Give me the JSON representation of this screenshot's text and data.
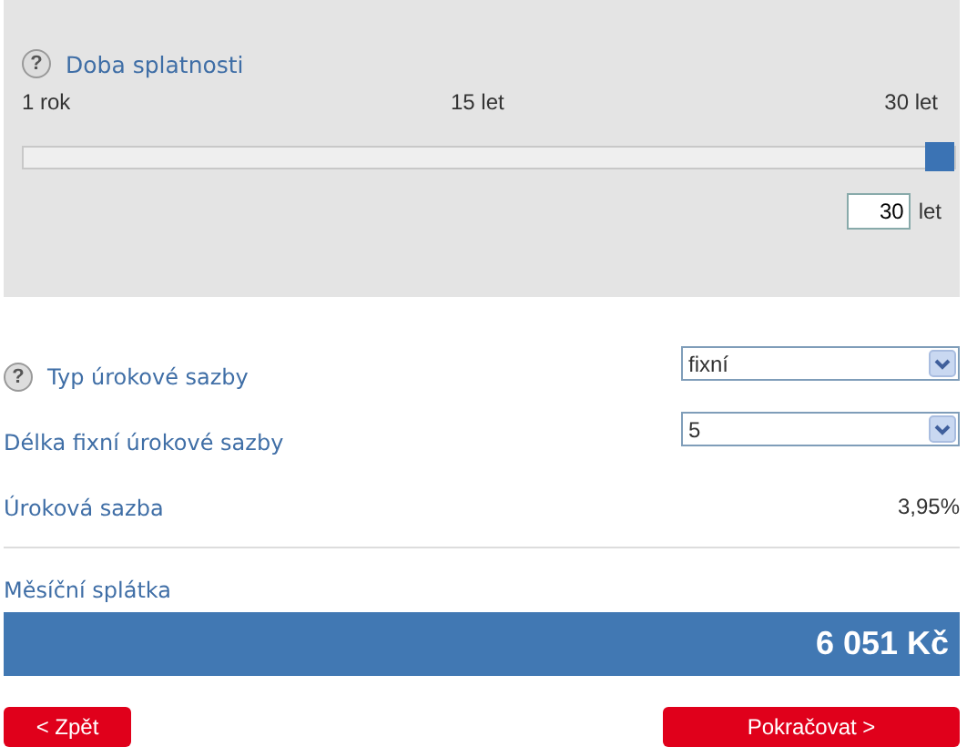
{
  "term": {
    "title": "Doba splatnosti",
    "help": "?",
    "scale": [
      "1 rok",
      "15 let",
      "30 let"
    ],
    "level": 1,
    "value": "30",
    "unit": "let"
  },
  "rows": [
    {
      "kind": "select",
      "label": "Typ úrokové sazby",
      "help": "?",
      "value": "fixní"
    },
    {
      "kind": "select",
      "label": "Délka fixní úrokové sazby",
      "value": "5"
    },
    {
      "kind": "text",
      "label": "Úroková sazba",
      "value": "3,95%"
    }
  ],
  "payment": {
    "label": "Měsíční splátka",
    "value": "6 051 Kč"
  },
  "buttons": {
    "back": "< Zpět",
    "next": "Pokračovat >"
  }
}
